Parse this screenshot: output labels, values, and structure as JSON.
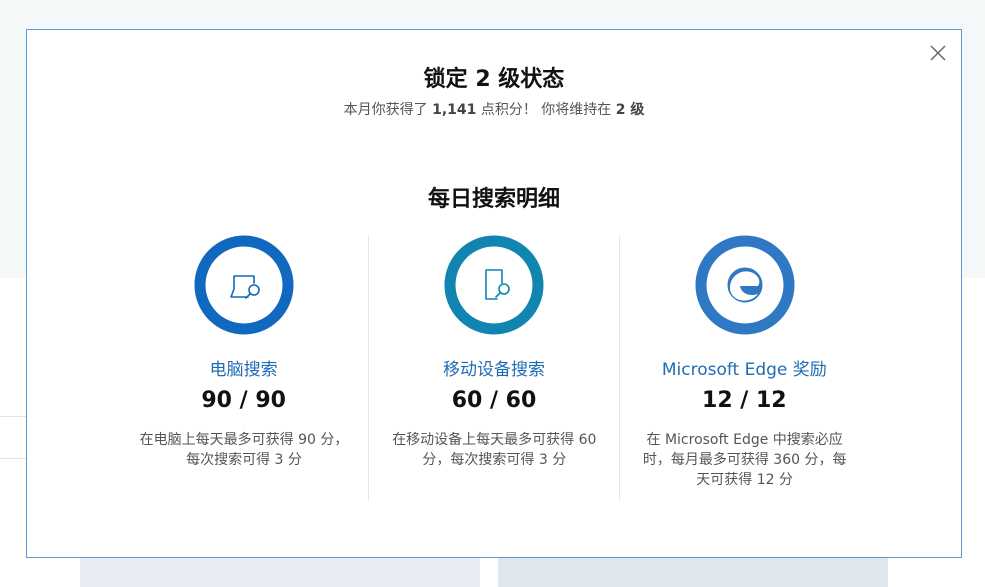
{
  "dialog": {
    "title": "锁定 2 级状态",
    "subtitle": {
      "prefix": "本月你获得了 ",
      "points": "1,141",
      "middle": " 点积分！  你将维持在 ",
      "level": "2 级"
    },
    "section_title": "每日搜索明细",
    "close_icon": "close-icon",
    "cards": [
      {
        "label": "电脑搜索",
        "score": "90 / 90",
        "desc": "在电脑上每天最多可获得 90 分，每次搜索可得 3 分",
        "icon": "pc-search-icon",
        "progress": 1.0,
        "ring_color": "#1068bf"
      },
      {
        "label": "移动设备搜索",
        "score": "60 / 60",
        "desc": "在移动设备上每天最多可获得 60 分，每次搜索可得 3 分",
        "icon": "mobile-search-icon",
        "progress": 1.0,
        "ring_color": "#0f85b0"
      },
      {
        "label": "Microsoft Edge 奖励",
        "score": "12 / 12",
        "desc": "在 Microsoft Edge 中搜索必应时，每月最多可获得 360 分，每天可获得 12 分",
        "icon": "edge-icon",
        "progress": 1.0,
        "ring_color": "#2f78c4"
      }
    ]
  }
}
